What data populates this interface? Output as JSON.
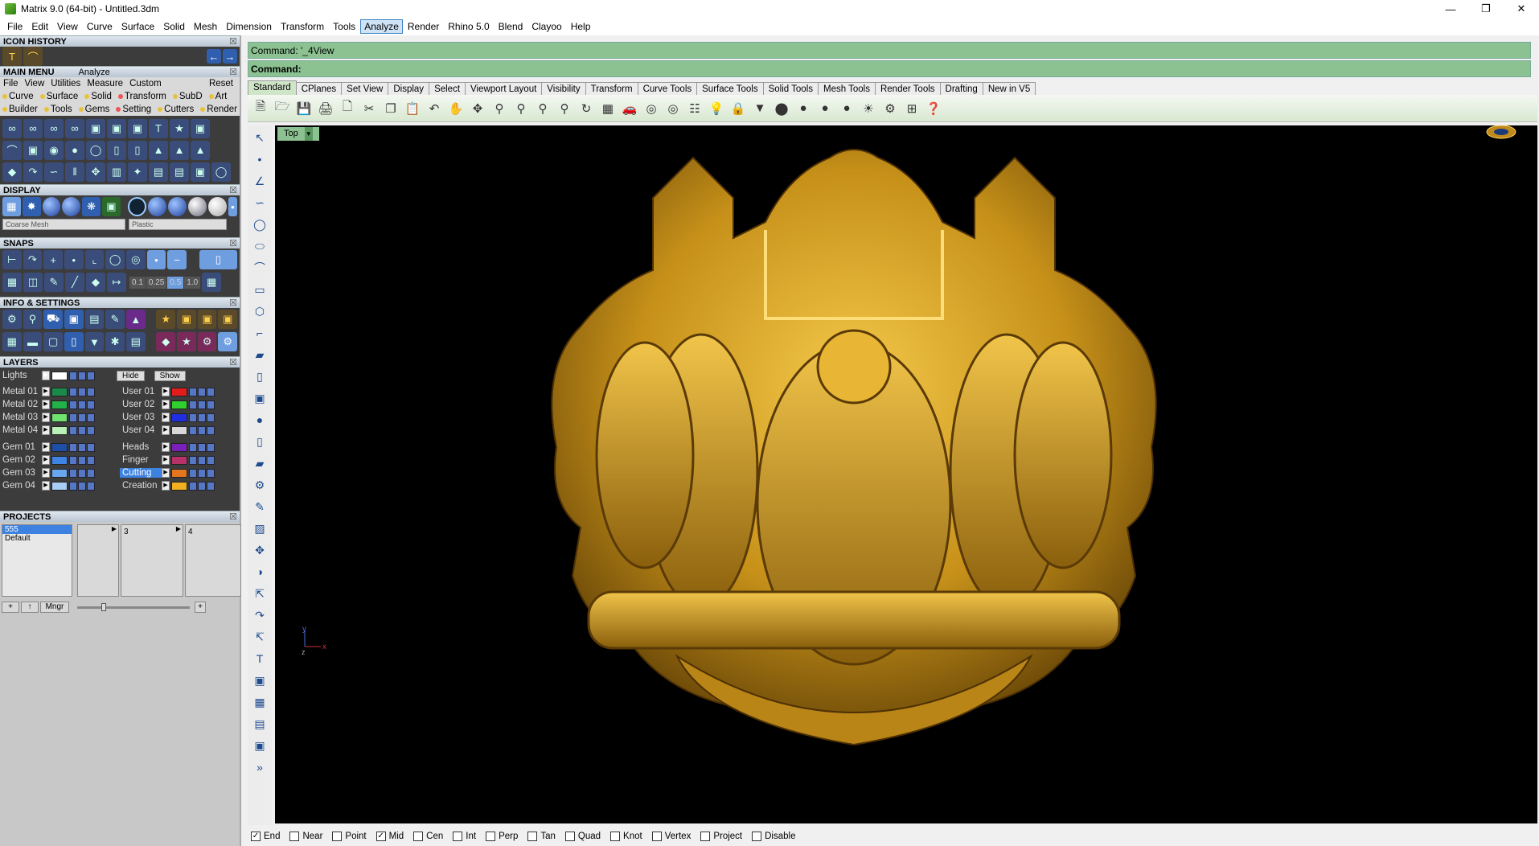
{
  "window": {
    "title": "Matrix 9.0 (64-bit) - Untitled.3dm"
  },
  "menubar": [
    "File",
    "Edit",
    "View",
    "Curve",
    "Surface",
    "Solid",
    "Mesh",
    "Dimension",
    "Transform",
    "Tools",
    "Analyze",
    "Render",
    "Rhino 5.0",
    "Blend",
    "Clayoo",
    "Help"
  ],
  "menubar_active": "Analyze",
  "left_panel": {
    "icon_history": {
      "title": "ICON HISTORY"
    },
    "main_menu": {
      "title": "MAIN MENU",
      "subtitle": "Analyze",
      "nav": [
        "File",
        "View",
        "Utilities",
        "Measure",
        "Custom"
      ],
      "reset": "Reset",
      "row1": [
        "Curve",
        "Surface",
        "Solid",
        "Transform",
        "SubD",
        "Art"
      ],
      "row2": [
        "Builder",
        "Tools",
        "Gems",
        "Setting",
        "Cutters",
        "Render"
      ]
    },
    "display": {
      "title": "DISPLAY",
      "mesh_select": "Coarse Mesh",
      "material_select": "Plastic"
    },
    "snaps": {
      "title": "SNAPS",
      "values": [
        "0.1",
        "0.25",
        "0.5",
        "1.0"
      ]
    },
    "info_settings": {
      "title": "INFO & SETTINGS"
    },
    "layers": {
      "title": "LAYERS",
      "lights_label": "Lights",
      "hide_label": "Hide",
      "show_label": "Show",
      "left": [
        {
          "name": "Metal 01",
          "color": "#1a8a4a"
        },
        {
          "name": "Metal 02",
          "color": "#23b24a"
        },
        {
          "name": "Metal 03",
          "color": "#6fe26f"
        },
        {
          "name": "Metal 04",
          "color": "#b8f0b8"
        },
        {
          "name": "Gem 01",
          "color": "#1d4fa8"
        },
        {
          "name": "Gem 02",
          "color": "#3f84e5"
        },
        {
          "name": "Gem 03",
          "color": "#6aa6f0"
        },
        {
          "name": "Gem 04",
          "color": "#a8cdf7"
        }
      ],
      "right": [
        {
          "name": "User 01",
          "color": "#e21b1b"
        },
        {
          "name": "User 02",
          "color": "#2ed12e"
        },
        {
          "name": "User 03",
          "color": "#1f2ee0"
        },
        {
          "name": "User 04",
          "color": "#d8d8d8"
        },
        {
          "name": "Heads",
          "color": "#7a1fb8"
        },
        {
          "name": "Finger",
          "color": "#b8326a"
        },
        {
          "name": "Cutting",
          "color": "#e5761f"
        },
        {
          "name": "Creation",
          "color": "#f0b020"
        }
      ],
      "selected": "Cutting"
    },
    "projects": {
      "title": "PROJECTS",
      "items": [
        "555",
        "Default"
      ],
      "columns": [
        "",
        "3",
        "4"
      ],
      "mngr": "Mngr"
    }
  },
  "command": {
    "history": "Command: '_4View",
    "prompt": "Command:"
  },
  "toolbar_tabs": [
    "Standard",
    "CPlanes",
    "Set View",
    "Display",
    "Select",
    "Viewport Layout",
    "Visibility",
    "Transform",
    "Curve Tools",
    "Surface Tools",
    "Solid Tools",
    "Mesh Tools",
    "Render Tools",
    "Drafting",
    "New in V5"
  ],
  "toolbar_active": "Standard",
  "viewport": {
    "name": "Top",
    "axis_x": "x",
    "axis_y": "y",
    "axis_z": "z"
  },
  "osnaps": [
    {
      "label": "End",
      "checked": true
    },
    {
      "label": "Near",
      "checked": false
    },
    {
      "label": "Point",
      "checked": false
    },
    {
      "label": "Mid",
      "checked": true
    },
    {
      "label": "Cen",
      "checked": false
    },
    {
      "label": "Int",
      "checked": false
    },
    {
      "label": "Perp",
      "checked": false
    },
    {
      "label": "Tan",
      "checked": false
    },
    {
      "label": "Quad",
      "checked": false
    },
    {
      "label": "Knot",
      "checked": false
    },
    {
      "label": "Vertex",
      "checked": false
    },
    {
      "label": "Project",
      "checked": false
    },
    {
      "label": "Disable",
      "checked": false
    }
  ],
  "colors": {
    "command_bg": "#8cc291",
    "gold": "#d9a424"
  }
}
